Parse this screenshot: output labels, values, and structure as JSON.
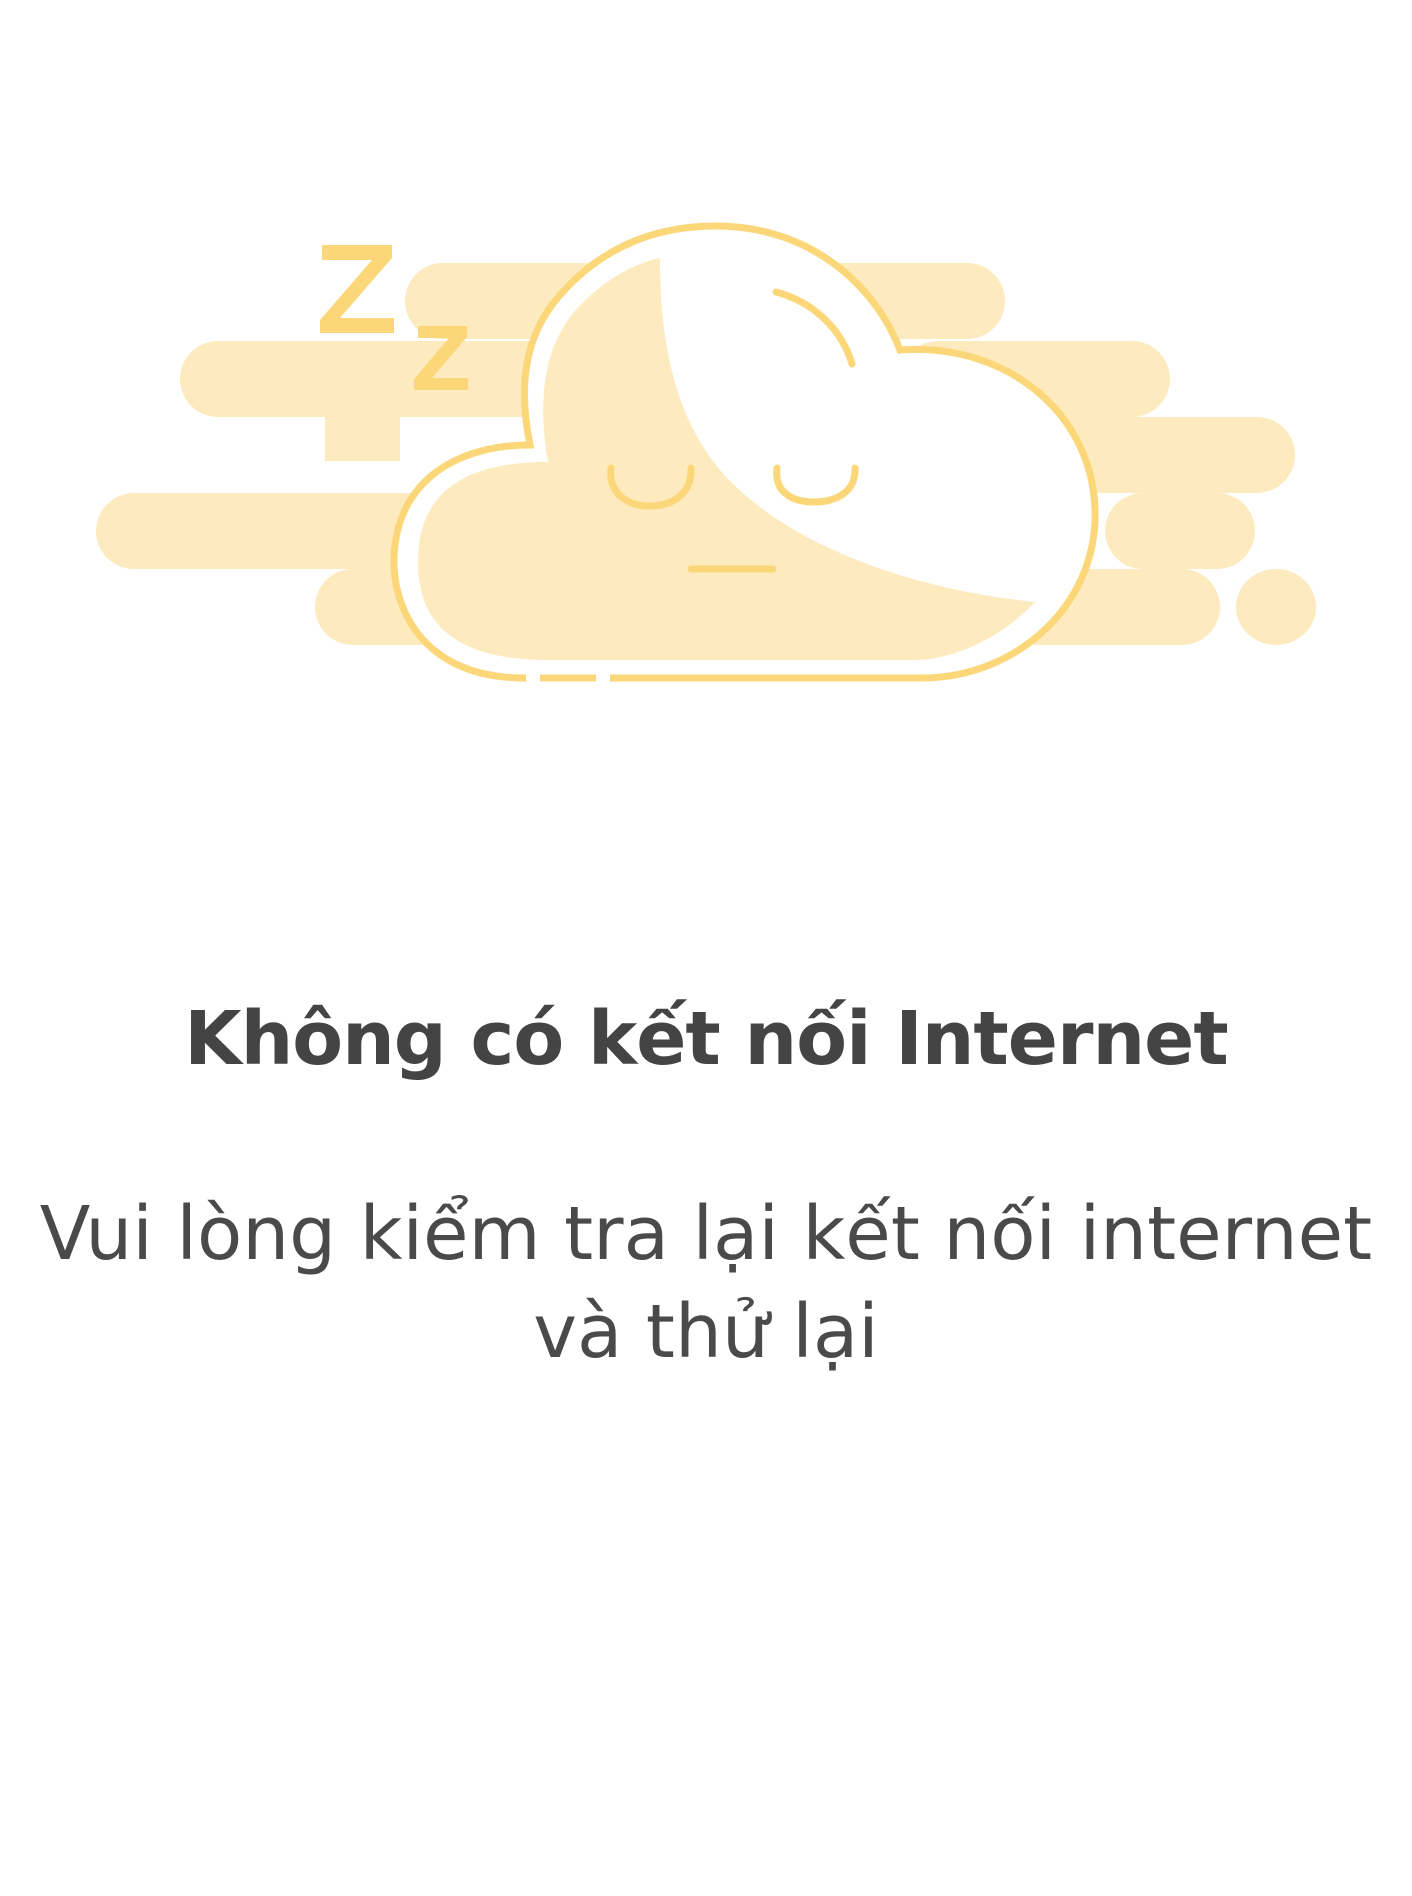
{
  "empty_state": {
    "illustration_icon": "sleeping-cloud-icon",
    "title": "Không có kết nối Internet",
    "subtitle": "Vui lòng kiểm tra lại kết nối internet và thử lại"
  },
  "colors": {
    "background": "#ffffff",
    "illustration_fill": "#fdebbf",
    "illustration_stroke": "#fbd77a",
    "text": "#444444"
  }
}
